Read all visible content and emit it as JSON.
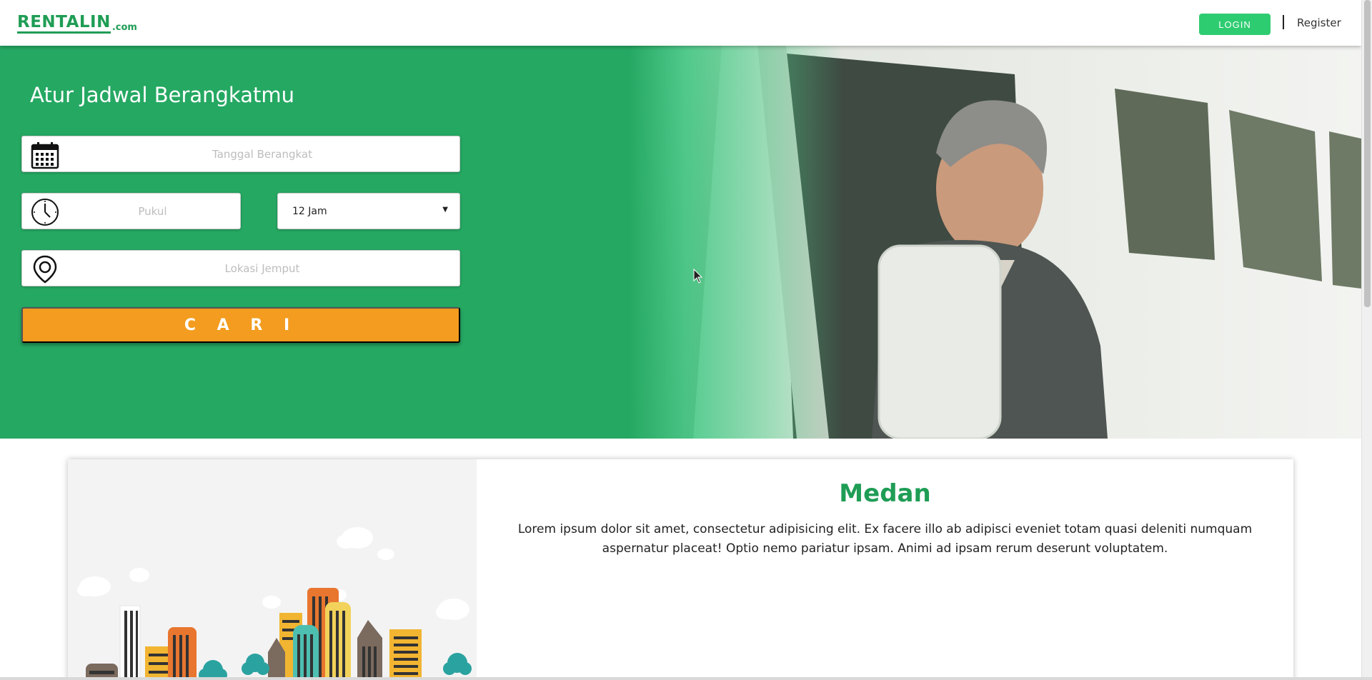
{
  "header": {
    "logo_main": "RENTALIN",
    "logo_tld": ".com",
    "login_label": "LOGIN",
    "register_label": "Register"
  },
  "hero": {
    "title": "Atur Jadwal Berangkatmu",
    "date_placeholder": "Tanggal Berangkat",
    "time_placeholder": "Pukul",
    "duration_selected": "12 Jam",
    "location_placeholder": "Lokasi Jemput",
    "search_label": "C A R I"
  },
  "card": {
    "title": "Medan",
    "description": "Lorem ipsum dolor sit amet, consectetur adipisicing elit. Ex facere illo ab adipisci eveniet totam quasi deleniti numquam aspernatur placeat! Optio nemo pariatur ipsam. Animi ad ipsam rerum deserunt voluptatem."
  },
  "colors": {
    "brand_green": "#25a862",
    "accent_orange": "#f39c1f",
    "login_green": "#2ecc71"
  }
}
